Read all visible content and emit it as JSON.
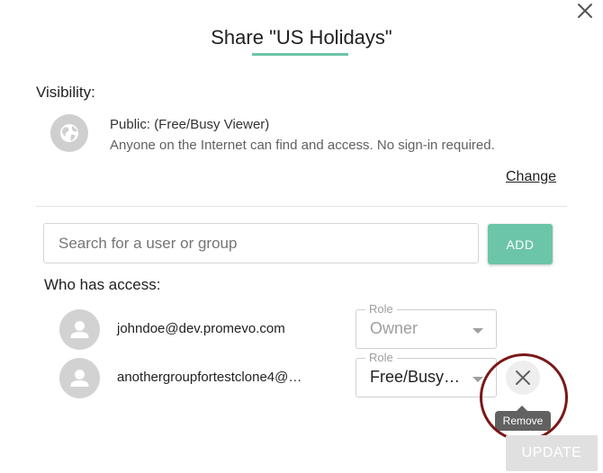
{
  "dialog": {
    "title": "Share \"US Holidays\"",
    "accent_color": "#6cc5a9"
  },
  "close_icon": "close-icon",
  "visibility": {
    "label": "Visibility:",
    "icon": "globe-icon",
    "title": "Public: (Free/Busy Viewer)",
    "description": "Anyone on the Internet can find and access. No sign-in required.",
    "change_label": "Change"
  },
  "search": {
    "placeholder": "Search for a user or group",
    "value": ""
  },
  "add_button": {
    "label": "ADD"
  },
  "access": {
    "label": "Who has access:",
    "users": [
      {
        "email": "johndoe@dev.promevo.com",
        "role_label": "Role",
        "role": "Owner",
        "role_disabled": true,
        "avatar_icon": "person-icon"
      },
      {
        "email": "anothergroupfortestclone4@…",
        "role_label": "Role",
        "role": "Free/Busy…",
        "role_disabled": false,
        "avatar_icon": "person-icon"
      }
    ]
  },
  "remove": {
    "icon": "close-icon",
    "tooltip": "Remove",
    "highlight_color": "#7a1818"
  },
  "update_button": {
    "label": "UPDATE",
    "disabled": true
  }
}
